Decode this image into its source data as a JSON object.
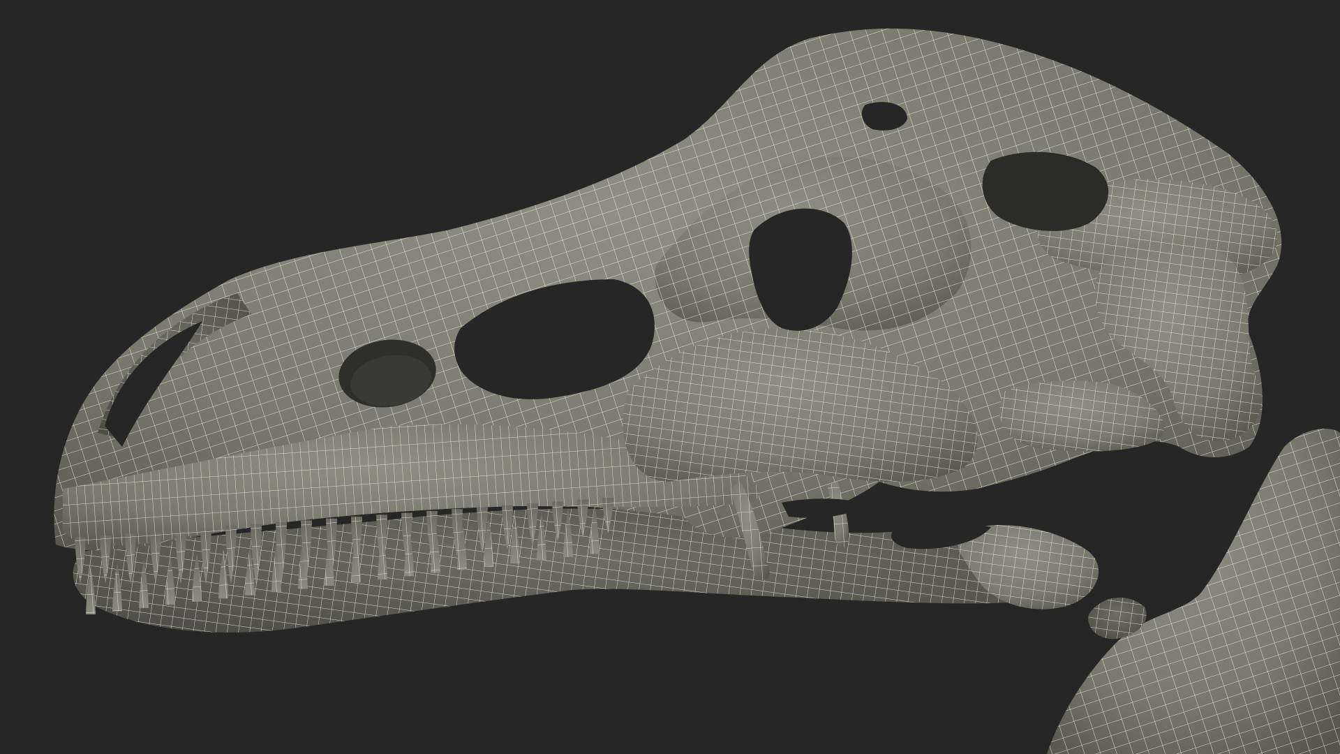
{
  "scene": {
    "background_color": "#262626",
    "bone_color": "#7d7c6f",
    "bone_shadow_color": "#55544b",
    "bone_highlight_color": "#97968a",
    "wire_color": "#f2f0e2",
    "hole_color": "#262626",
    "subject": "dinosaur-skull-wireframe-render"
  }
}
